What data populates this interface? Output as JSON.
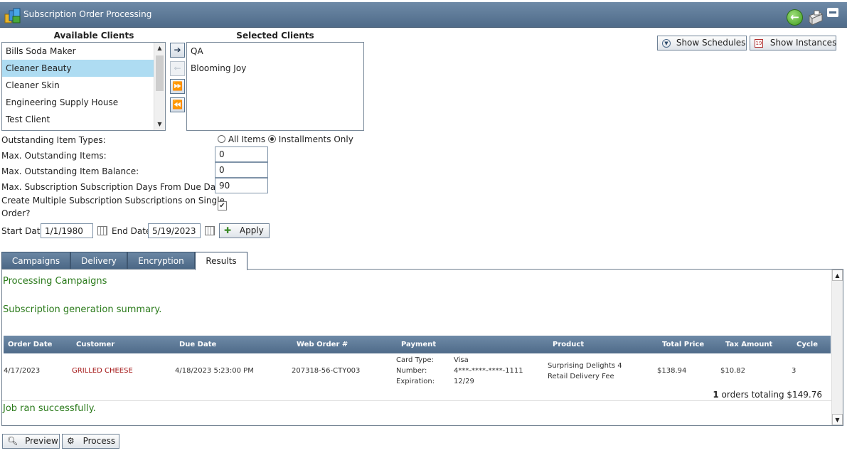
{
  "window": {
    "title": "Subscription Order Processing"
  },
  "available_clients": {
    "header": "Available Clients",
    "items": [
      "Bills Soda Maker",
      "Cleaner Beauty",
      "Cleaner Skin",
      "Engineering Supply House",
      "Test Client"
    ],
    "selected_index": 1
  },
  "selected_clients": {
    "header": "Selected Clients",
    "items": [
      "QA",
      "Blooming Joy"
    ]
  },
  "move_buttons": {
    "add": "➔",
    "remove": "⇽",
    "add_all": "⏩",
    "remove_all": "⏪"
  },
  "top_buttons": {
    "show_schedules": "Show Schedules",
    "show_instances": "Show Instances"
  },
  "form": {
    "outstanding_item_types_label": "Outstanding Item Types:",
    "all_items_label": "All Items",
    "installments_only_label": "Installments Only",
    "selected_item_type": "Installments Only",
    "max_outstanding_items_label": "Max. Outstanding Items:",
    "max_outstanding_items": "0",
    "max_outstanding_balance_label": "Max. Outstanding Item Balance:",
    "max_outstanding_balance": "0",
    "max_days_label": "Max. Subscription Subscription Days From Due Date:",
    "max_days": "90",
    "create_multiple_label_1": "Create Multiple Subscription Subscriptions on Single",
    "create_multiple_label_2": "Order?",
    "create_multiple_checked": true,
    "start_date_label": "Start Date:",
    "start_date": "1/1/1980",
    "end_date_label": "End Date:",
    "end_date": "5/19/2023",
    "apply_label": "Apply"
  },
  "tabs": [
    {
      "label": "Campaigns",
      "active": false
    },
    {
      "label": "Delivery",
      "active": false
    },
    {
      "label": "Encryption",
      "active": false
    },
    {
      "label": "Results",
      "active": true
    }
  ],
  "results": {
    "processing_text": "Processing Campaigns",
    "summary_text": "Subscription generation summary.",
    "columns": [
      "Order Date",
      "Customer",
      "Due Date",
      "Web Order #",
      "Payment",
      "Product",
      "Total Price",
      "Tax Amount",
      "Cycle"
    ],
    "row": {
      "order_date": "4/17/2023",
      "customer": "GRILLED CHEESE",
      "due_date": "4/18/2023 5:23:00 PM",
      "web_order": "207318-56-CTY003",
      "payment": {
        "card_type_label": "Card Type:",
        "card_type": "Visa",
        "number_label": "Number:",
        "number": "4***-****-****-1111",
        "expiration_label": "Expiration:",
        "expiration": "12/29"
      },
      "products": [
        "Surprising Delights 4",
        "Retail Delivery Fee"
      ],
      "total_price": "$138.94",
      "tax_amount": "$10.82",
      "cycle": "3"
    },
    "orders_count": "1",
    "orders_total_text": "orders totaling $149.76",
    "job_status": "Job ran successfully."
  },
  "bottom_buttons": {
    "preview": "Preview",
    "process": "Process"
  },
  "colors": {
    "header_blue": "#5a7694",
    "green_text": "#2a7a1a",
    "selection": "#aedcf2",
    "customer_red": "#a31515"
  }
}
